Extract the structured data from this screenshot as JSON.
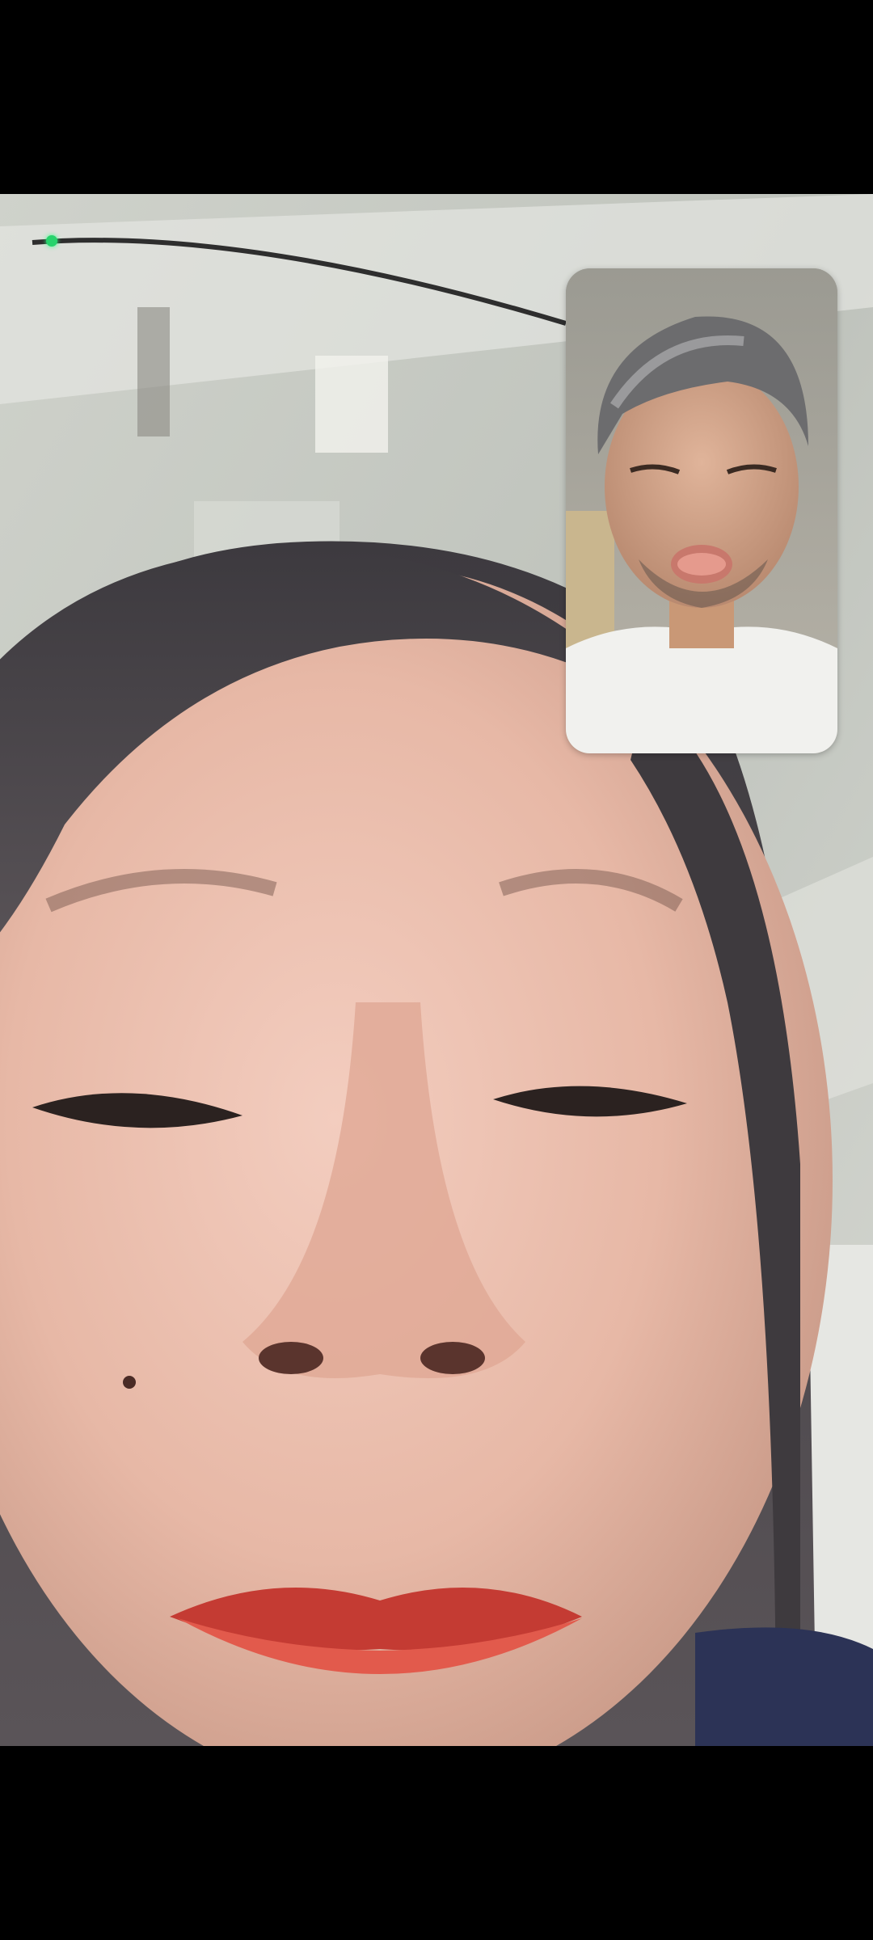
{
  "call": {
    "remote_video": "remote-participant-video",
    "self_preview": "local-camera-preview",
    "camera_active_indicator": "camera-in-use-dot"
  },
  "colors": {
    "background": "#000000",
    "indicator": "#27d36c",
    "preview_border": "#ffffff"
  }
}
